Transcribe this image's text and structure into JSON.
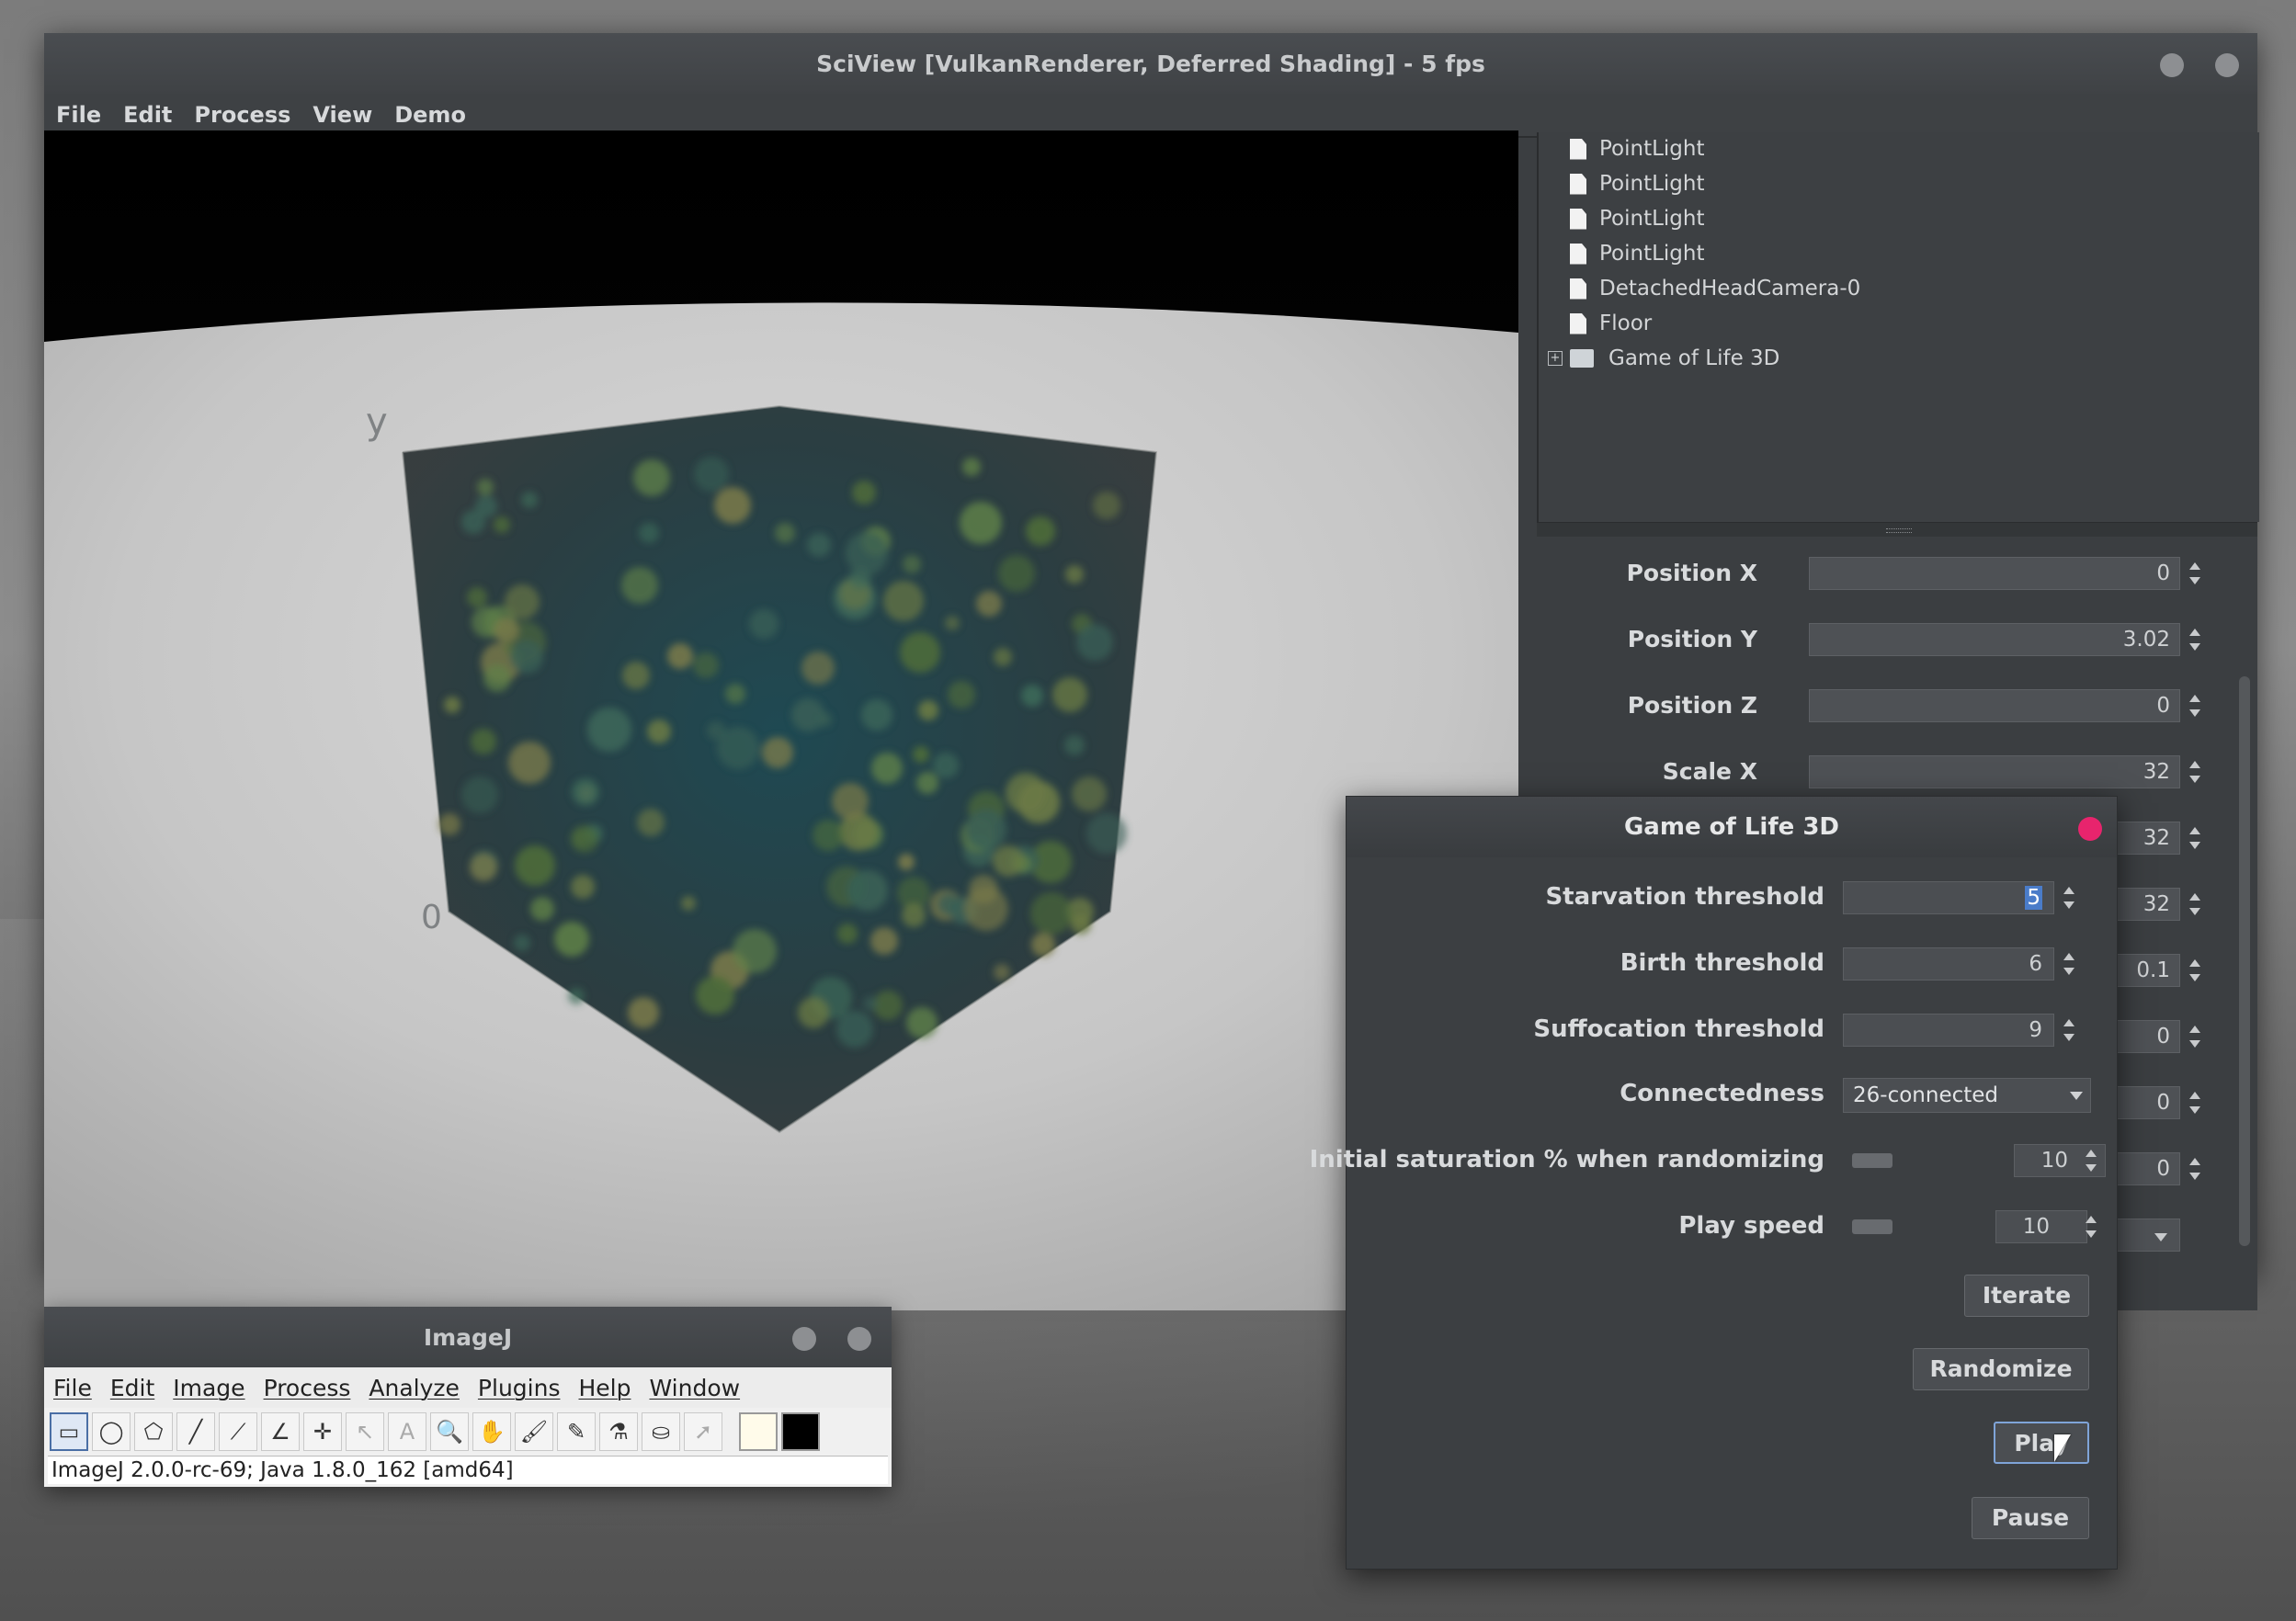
{
  "sciview": {
    "title": "SciView [VulkanRenderer, Deferred Shading]  - 5 fps",
    "menu": [
      "File",
      "Edit",
      "Process",
      "View",
      "Demo"
    ],
    "axis_labels": {
      "y": "y",
      "origin": "0"
    },
    "tree": {
      "items": [
        {
          "label": "PointLight",
          "icon": "file-icon"
        },
        {
          "label": "PointLight",
          "icon": "file-icon"
        },
        {
          "label": "PointLight",
          "icon": "file-icon"
        },
        {
          "label": "PointLight",
          "icon": "file-icon"
        },
        {
          "label": "DetachedHeadCamera-0",
          "icon": "file-icon"
        },
        {
          "label": "Floor",
          "icon": "file-icon"
        },
        {
          "label": "Game of Life 3D",
          "icon": "folder-icon",
          "expander": "+"
        }
      ]
    },
    "properties": [
      {
        "label": "Position X",
        "value": "0"
      },
      {
        "label": "Position Y",
        "value": "3.02"
      },
      {
        "label": "Position Z",
        "value": "0"
      },
      {
        "label": "Scale X",
        "value": "32"
      },
      {
        "label": "",
        "value": "32"
      },
      {
        "label": "",
        "value": "32"
      },
      {
        "label": "",
        "value": "0.1"
      },
      {
        "label": "",
        "value": "0"
      },
      {
        "label": "",
        "value": "0"
      },
      {
        "label": "",
        "value": "0"
      }
    ]
  },
  "imagej": {
    "title": "ImageJ",
    "menu": [
      "File",
      "Edit",
      "Image",
      "Process",
      "Analyze",
      "Plugins",
      "Help",
      "Window"
    ],
    "tools": [
      {
        "name": "rectangle-tool",
        "glyph": "▭",
        "selected": true
      },
      {
        "name": "oval-tool",
        "glyph": "◯"
      },
      {
        "name": "polygon-tool",
        "glyph": "⬠"
      },
      {
        "name": "line-tool",
        "glyph": "╱"
      },
      {
        "name": "angle-line-tool",
        "glyph": "⟋"
      },
      {
        "name": "angle-tool",
        "glyph": "∠"
      },
      {
        "name": "point-tool",
        "glyph": "✛"
      },
      {
        "name": "wand-tool",
        "glyph": "↖",
        "dim": true
      },
      {
        "name": "text-tool",
        "glyph": "A",
        "dim": true
      },
      {
        "name": "magnifier-tool",
        "glyph": "🔍"
      },
      {
        "name": "hand-tool",
        "glyph": "✋"
      },
      {
        "name": "brush-tool",
        "glyph": "🖌"
      },
      {
        "name": "pencil-tool",
        "glyph": "✎"
      },
      {
        "name": "dropper-tool",
        "glyph": "⚗"
      },
      {
        "name": "flood-fill-tool",
        "glyph": "⛀"
      },
      {
        "name": "arrow-tool",
        "glyph": "➚",
        "dim": true
      }
    ],
    "foreground_color": "#fffbea",
    "background_color": "#000000",
    "status": "ImageJ 2.0.0-rc-69; Java 1.8.0_162 [amd64]"
  },
  "game_of_life": {
    "title": "Game of Life 3D",
    "starvation": {
      "label": "Starvation threshold",
      "value": "5"
    },
    "birth": {
      "label": "Birth threshold",
      "value": "6"
    },
    "suffocation": {
      "label": "Suffocation threshold",
      "value": "9"
    },
    "connectedness": {
      "label": "Connectedness",
      "value": "26-connected"
    },
    "saturation": {
      "label": "Initial saturation % when randomizing",
      "value": "10"
    },
    "play_speed": {
      "label": "Play speed",
      "value": "10"
    },
    "buttons": {
      "iterate": "Iterate",
      "randomize": "Randomize",
      "play": "Play",
      "pause": "Pause"
    }
  }
}
